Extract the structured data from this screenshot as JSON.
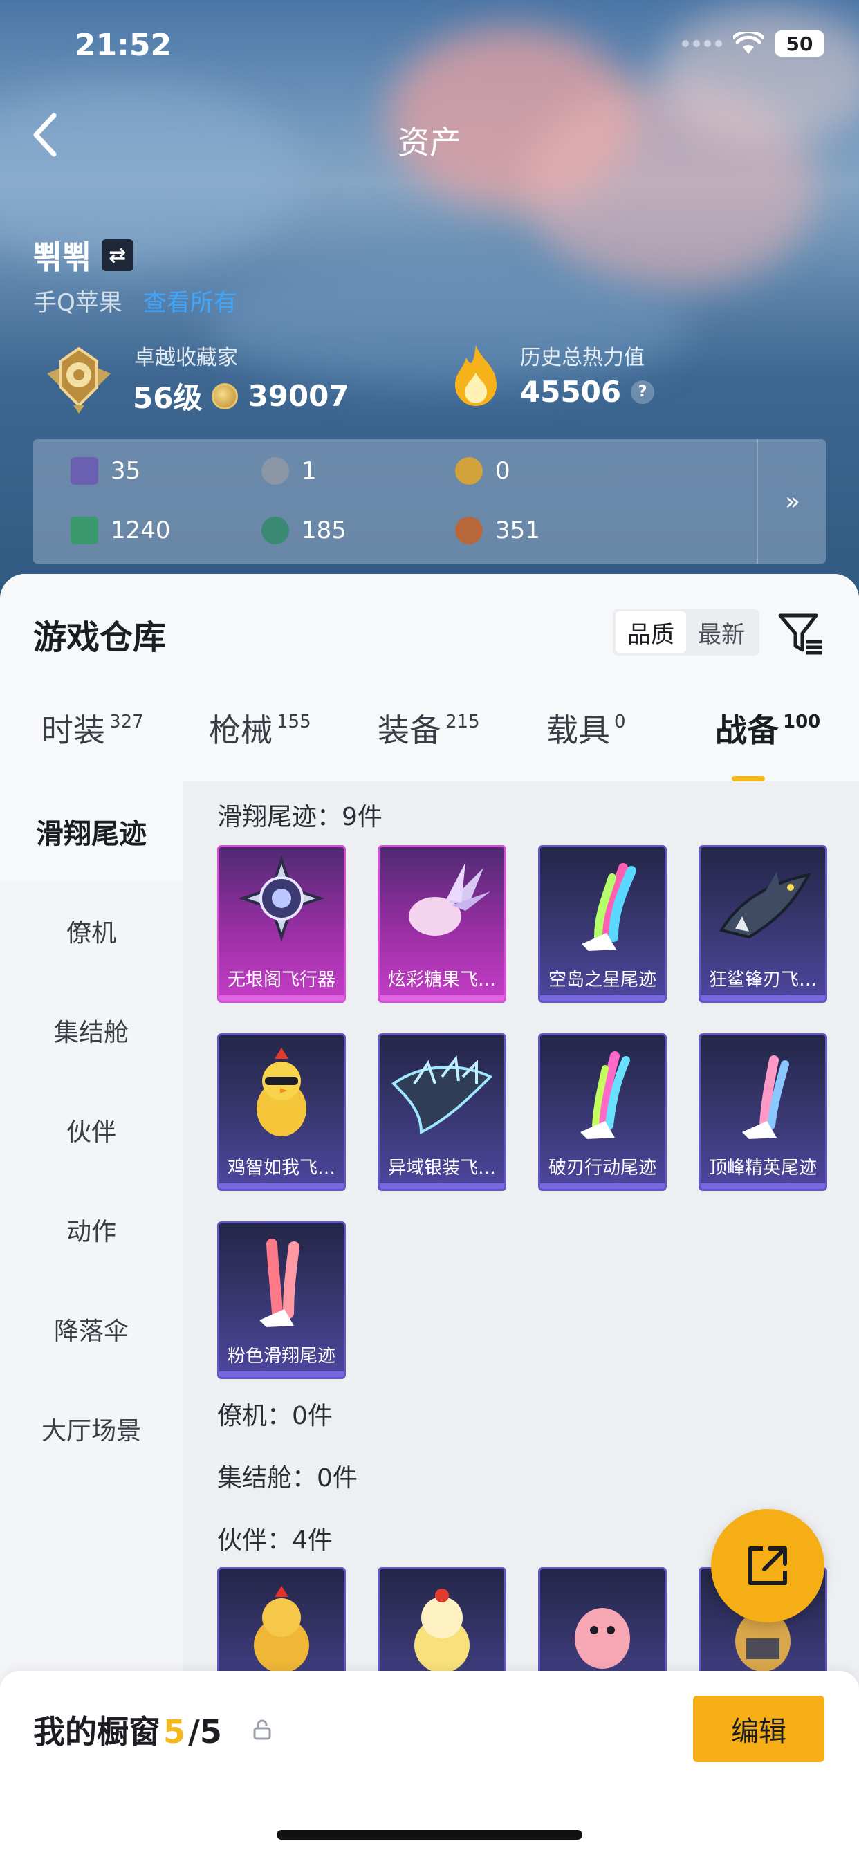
{
  "status": {
    "time": "21:52",
    "battery": "50"
  },
  "header": {
    "title": "资产"
  },
  "user": {
    "name": "뾖뾖",
    "platform": "手Q苹果",
    "link_text": "查看所有"
  },
  "collector": {
    "title": "卓越收藏家",
    "level": "56级",
    "points": "39007"
  },
  "heat": {
    "label": "历史总热力值",
    "value": "45506",
    "help": "?"
  },
  "currencies": [
    {
      "icon": "purple-card-icon",
      "value": "35",
      "color": "#6a5fb0"
    },
    {
      "icon": "silver-coin-icon",
      "value": "1",
      "color": "#8b96a6"
    },
    {
      "icon": "gold-coin-icon",
      "value": "0",
      "color": "#d3a33b"
    },
    {
      "icon": "green-ticket-icon",
      "value": "1240",
      "color": "#3b9a6d"
    },
    {
      "icon": "teal-orb-icon",
      "value": "185",
      "color": "#3a8a73"
    },
    {
      "icon": "bronze-coin-icon",
      "value": "351",
      "color": "#b8673a"
    }
  ],
  "warehouse": {
    "title": "游戏仓库",
    "sort": {
      "quality": "品质",
      "newest": "最新"
    },
    "tabs": [
      {
        "label": "时装",
        "count": "327"
      },
      {
        "label": "枪械",
        "count": "155"
      },
      {
        "label": "装备",
        "count": "215"
      },
      {
        "label": "载具",
        "count": "0"
      },
      {
        "label": "战备",
        "count": "100"
      }
    ]
  },
  "sidebar": [
    "滑翔尾迹",
    "僚机",
    "集结舱",
    "伙伴",
    "动作",
    "降落伞",
    "大厅场景"
  ],
  "sections": {
    "trail": "滑翔尾迹：9件",
    "wingman": "僚机：0件",
    "capsule": "集结舱：0件",
    "partner": "伙伴：4件"
  },
  "trail_items": [
    {
      "name": "无垠阁飞行器",
      "rarity": "purple",
      "art": "emblem-art"
    },
    {
      "name": "炫彩糖果飞…",
      "rarity": "purple",
      "art": "candy-art"
    },
    {
      "name": "空岛之星尾迹",
      "rarity": "blue",
      "art": "rainbow-trail-art"
    },
    {
      "name": "狂鲨锋刃飞…",
      "rarity": "blue",
      "art": "shark-art"
    },
    {
      "name": "鸡智如我飞…",
      "rarity": "blue",
      "art": "chicken-art"
    },
    {
      "name": "异域银装飞…",
      "rarity": "blue",
      "art": "wing-art"
    },
    {
      "name": "破刃行动尾迹",
      "rarity": "blue",
      "art": "rainbow-trail-art"
    },
    {
      "name": "顶峰精英尾迹",
      "rarity": "blue",
      "art": "rainbow-trail-art"
    },
    {
      "name": "粉色滑翔尾迹",
      "rarity": "blue",
      "art": "pink-trail-art"
    }
  ],
  "partner_items": [
    {
      "art": "chicken-partner-art"
    },
    {
      "art": "chick-partner-art"
    },
    {
      "art": "bird-partner-art"
    },
    {
      "art": "owl-partner-art"
    }
  ],
  "showcase": {
    "title": "我的橱窗",
    "current": "5",
    "total": "/5",
    "edit_label": "编辑"
  }
}
